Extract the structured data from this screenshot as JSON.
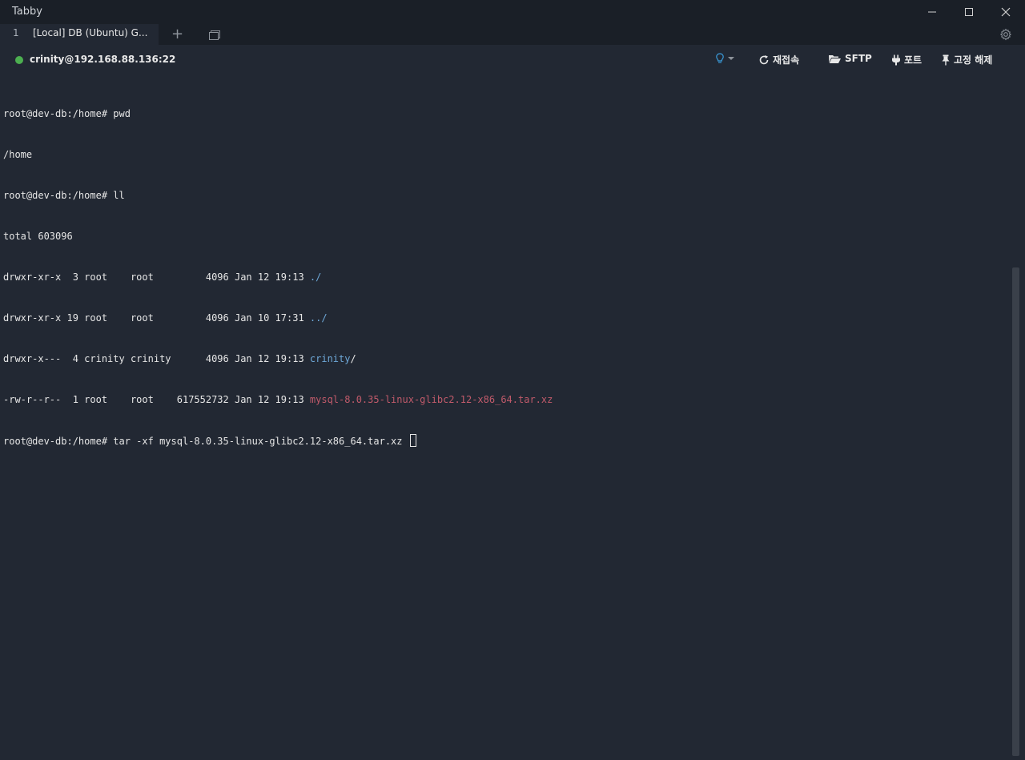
{
  "window": {
    "app_title": "Tabby",
    "controls": [
      "minimize",
      "maximize",
      "close"
    ]
  },
  "tabs": {
    "items": [
      {
        "number": "1",
        "title": "[Local] DB (Ubuntu) G..."
      }
    ],
    "add_label": "+"
  },
  "header": {
    "host": "crinity@192.168.88.136:22",
    "status_color": "#4caf50",
    "reconnect_label": "재접속",
    "sftp_label": "SFTP",
    "ports_label": "포트",
    "unpin_label": "고정 해제"
  },
  "terminal": {
    "lines": [
      {
        "text": "root@dev-db:/home# pwd"
      },
      {
        "text": "/home"
      },
      {
        "text": "root@dev-db:/home# ll"
      },
      {
        "text": "total 603096"
      },
      {
        "prefix": "drwxr-xr-x  3 root    root         4096 Jan 12 19:13 ",
        "name": "./",
        "kind": "dir"
      },
      {
        "prefix": "drwxr-xr-x 19 root    root         4096 Jan 10 17:31 ",
        "name": "../",
        "kind": "dir"
      },
      {
        "prefix": "drwxr-x---  4 crinity crinity      4096 Jan 12 19:13 ",
        "name": "crinity",
        "suffix": "/",
        "kind": "dir"
      },
      {
        "prefix": "-rw-r--r--  1 root    root    617552732 Jan 12 19:13 ",
        "name": "mysql-8.0.35-linux-glibc2.12-x86_64.tar.xz",
        "kind": "archive"
      },
      {
        "text": "root@dev-db:/home# tar -xf mysql-8.0.35-linux-glibc2.12-x86_64.tar.xz ",
        "cursor": true
      }
    ]
  },
  "colors": {
    "background": "#222833",
    "directory": "#6ea8d8",
    "archive": "#c05a6a"
  }
}
